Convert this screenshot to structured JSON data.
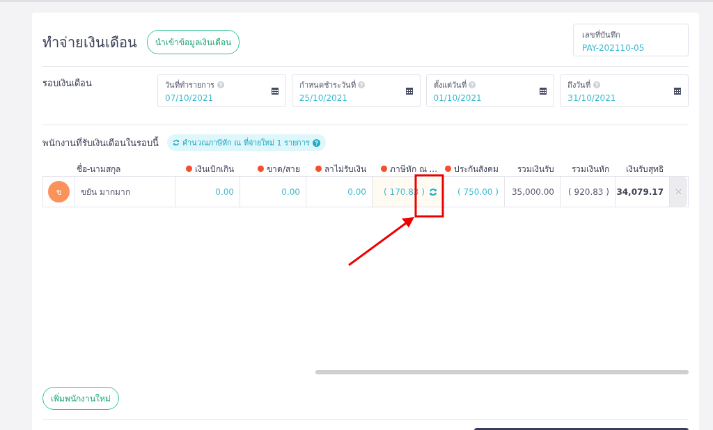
{
  "page_title": "ทำจ่ายเงินเดือน",
  "import_button": "นำเข้าข้อมูลเงินเดือน",
  "record_no": {
    "label": "เลขที่บันทึก",
    "value": "PAY-202110-05"
  },
  "period": {
    "label": "รอบเงินเดือน",
    "fields": [
      {
        "label": "วันที่ทำรายการ",
        "value": "07/10/2021"
      },
      {
        "label": "กำหนดชำระวันที่",
        "value": "25/10/2021"
      },
      {
        "label": "ตั้งแต่วันที่",
        "value": "01/10/2021"
      },
      {
        "label": "ถึงวันที่",
        "value": "31/10/2021"
      }
    ]
  },
  "employees": {
    "title": "พนักงานที่รับเงินเดือนในรอบนี้",
    "recalc_badge": "คำนวณภาษีหัก ณ ที่จ่ายใหม่ 1 รายการ",
    "columns": [
      {
        "label": "ชื่อ-นามสกุล",
        "dot": false
      },
      {
        "label": "เงินเบิกเกิน",
        "dot": true
      },
      {
        "label": "ขาด/สาย",
        "dot": true
      },
      {
        "label": "ลาไม่รับเงิน",
        "dot": true
      },
      {
        "label": "ภาษีหัก ณ ...",
        "dot": true
      },
      {
        "label": "ประกันสังคม",
        "dot": true
      },
      {
        "label": "รวมเงินรับ",
        "dot": false
      },
      {
        "label": "รวมเงินหัก",
        "dot": false
      },
      {
        "label": "เงินรับสุทธิ",
        "dot": false
      }
    ],
    "rows": [
      {
        "avatar": "ข",
        "cells": [
          {
            "value": "ขยัน มากมาก",
            "kind": "name"
          },
          {
            "value": "0.00",
            "kind": "editable"
          },
          {
            "value": "0.00",
            "kind": "editable"
          },
          {
            "value": "0.00",
            "kind": "editable"
          },
          {
            "value": "( 170.83 )",
            "kind": "tax"
          },
          {
            "value": "( 750.00 )",
            "kind": "editable"
          },
          {
            "value": "35,000.00",
            "kind": "sum"
          },
          {
            "value": "( 920.83 )",
            "kind": "sum"
          },
          {
            "value": "34,079.17",
            "kind": "net"
          }
        ]
      }
    ]
  },
  "add_button": "เพิ่มพนักงานใหม่"
}
